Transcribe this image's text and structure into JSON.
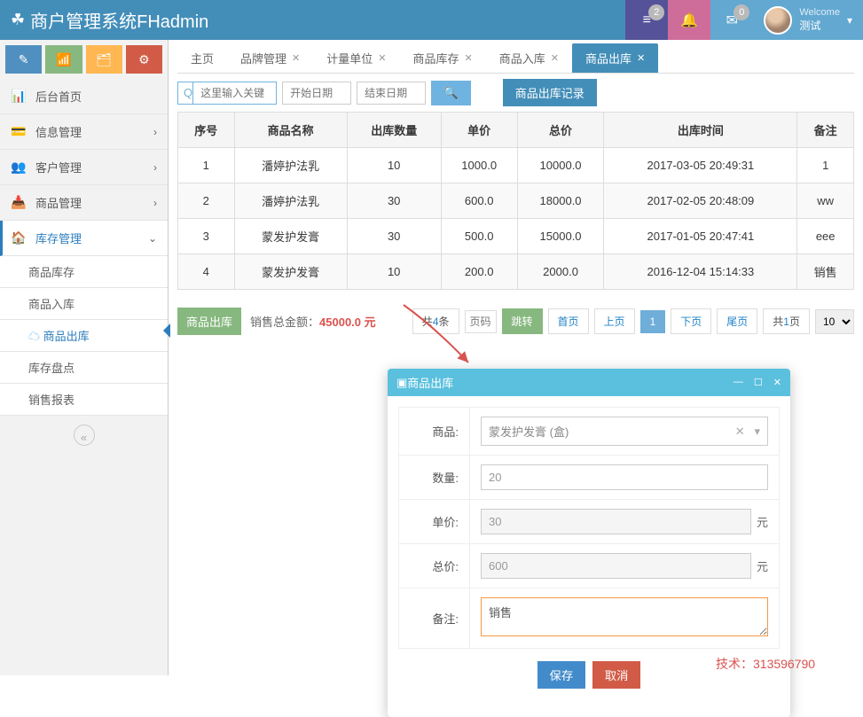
{
  "header": {
    "brand": "商户管理系统FHadmin",
    "badge1": "2",
    "badge2": "0",
    "welcome": "Welcome",
    "user": "测试"
  },
  "sidebar": {
    "items": [
      {
        "icon": "📊",
        "label": "后台首页"
      },
      {
        "icon": "💳",
        "label": "信息管理",
        "hasChildren": true
      },
      {
        "icon": "👥",
        "label": "客户管理",
        "hasChildren": true
      },
      {
        "icon": "📥",
        "label": "商品管理",
        "hasChildren": true
      },
      {
        "icon": "🏠",
        "label": "库存管理",
        "hasChildren": true,
        "active": true
      }
    ],
    "subItems": [
      {
        "label": "商品库存"
      },
      {
        "label": "商品入库"
      },
      {
        "label": "商品出库",
        "active": true,
        "cloud": true
      },
      {
        "label": "库存盘点"
      },
      {
        "label": "销售报表"
      }
    ]
  },
  "tabs": [
    {
      "label": "主页"
    },
    {
      "label": "品牌管理",
      "closable": true
    },
    {
      "label": "计量单位",
      "closable": true
    },
    {
      "label": "商品库存",
      "closable": true
    },
    {
      "label": "商品入库",
      "closable": true
    },
    {
      "label": "商品出库",
      "closable": true,
      "active": true
    }
  ],
  "filters": {
    "searchPh": "这里输入关键",
    "startPh": "开始日期",
    "endPh": "结束日期",
    "recordBtn": "商品出库记录"
  },
  "table": {
    "headers": [
      "序号",
      "商品名称",
      "出库数量",
      "单价",
      "总价",
      "出库时间",
      "备注"
    ],
    "rows": [
      [
        "1",
        "潘婷护法乳",
        "10",
        "1000.0",
        "10000.0",
        "2017-03-05 20:49:31",
        "1"
      ],
      [
        "2",
        "潘婷护法乳",
        "30",
        "600.0",
        "18000.0",
        "2017-02-05 20:48:09",
        "ww"
      ],
      [
        "3",
        "蒙发护发膏",
        "30",
        "500.0",
        "15000.0",
        "2017-01-05 20:47:41",
        "eee"
      ],
      [
        "4",
        "蒙发护发膏",
        "10",
        "200.0",
        "2000.0",
        "2016-12-04 15:14:33",
        "销售"
      ]
    ]
  },
  "bottom": {
    "outBtn": "商品出库",
    "totalLabel": "销售总金额：",
    "totalAmount": "45000.0 元"
  },
  "pagination": {
    "countPrefix": "共",
    "countNum": "4",
    "countSuffix": "条",
    "pagePh": "页码",
    "jump": "跳转",
    "first": "首页",
    "prev": "上页",
    "current": "1",
    "next": "下页",
    "last": "尾页",
    "totalPagesPrefix": "共",
    "totalPagesNum": "1",
    "totalPagesSuffix": "页",
    "pageSize": "10"
  },
  "modal": {
    "title": "商品出库",
    "productLabel": "商品:",
    "productValue": "蒙发护发膏 (盒)",
    "qtyLabel": "数量:",
    "qtyValue": "20",
    "priceLabel": "单价:",
    "priceValue": "30",
    "totalLabel": "总价:",
    "totalValue": "600",
    "unitYuan": "元",
    "remarkLabel": "备注:",
    "remarkValue": "销售",
    "save": "保存",
    "cancel": "取消"
  },
  "tech": "技术：313596790"
}
